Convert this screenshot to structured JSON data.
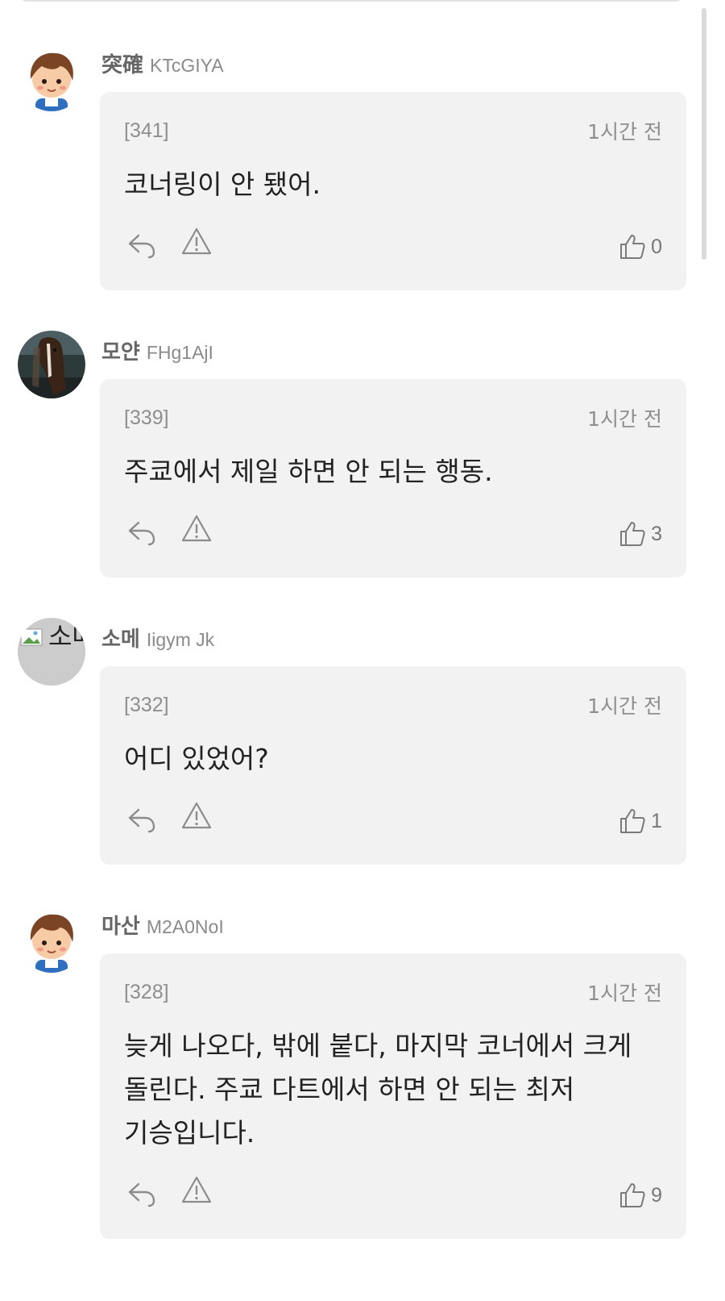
{
  "comments": [
    {
      "nickname": "突確",
      "user_id": "KTcGIYA",
      "number": "[341]",
      "time": "1시간 전",
      "text": "코너링이 안 됐어.",
      "likes": "0",
      "avatar": "boy-face-avatar"
    },
    {
      "nickname": "모얀",
      "user_id": "FHg1AjI",
      "number": "[339]",
      "time": "1시간 전",
      "text": "주쿄에서 제일 하면 안 되는 행동.",
      "likes": "3",
      "avatar": "horse-photo-avatar"
    },
    {
      "nickname": "소메",
      "user_id": "Iigym Jk",
      "number": "[332]",
      "time": "1시간 전",
      "text": "어디 있었어?",
      "likes": "1",
      "avatar": "broken-image-avatar",
      "avatar_alt": "소메"
    },
    {
      "nickname": "마산",
      "user_id": "M2A0NoI",
      "number": "[328]",
      "time": "1시간 전",
      "text": "늦게 나오다, 밖에 붙다, 마지막 코너에서 크게 돌린다. 주쿄 다트에서 하면 안 되는 최저 기승입니다.",
      "likes": "9",
      "avatar": "boy-face-avatar"
    }
  ],
  "icons": {
    "reply": "reply-icon",
    "report": "warning-triangle-icon",
    "like": "thumbs-up-icon"
  },
  "colors": {
    "bubble": "#f2f2f2",
    "nickname": "#666666",
    "meta": "#8f8f8f"
  }
}
